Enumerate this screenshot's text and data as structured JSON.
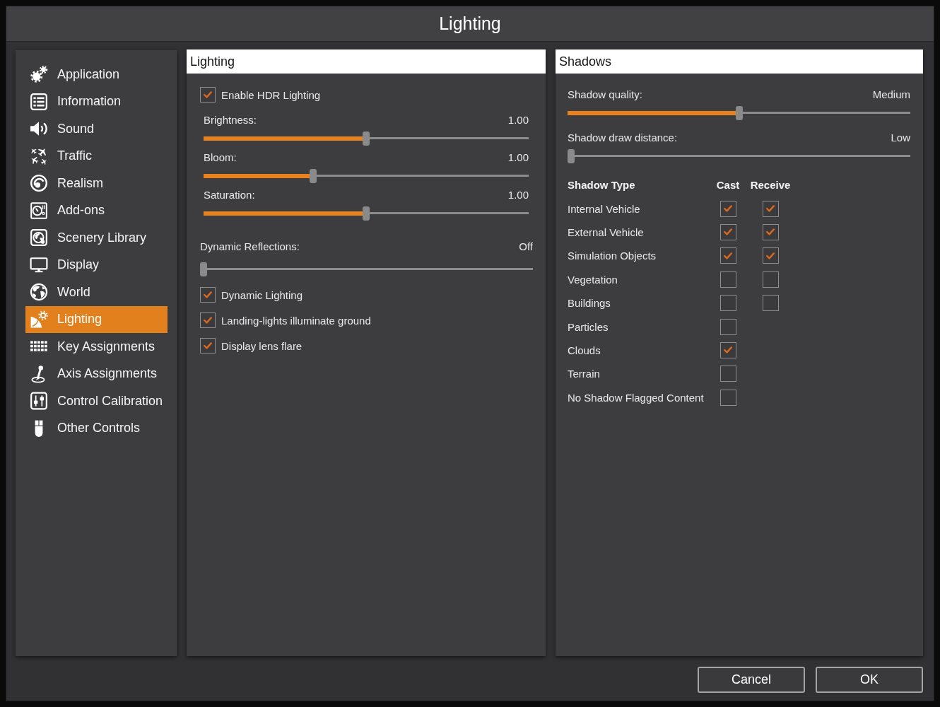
{
  "window": {
    "title": "Lighting"
  },
  "sidebar": {
    "items": [
      {
        "label": "Application",
        "selected": false
      },
      {
        "label": "Information",
        "selected": false
      },
      {
        "label": "Sound",
        "selected": false
      },
      {
        "label": "Traffic",
        "selected": false
      },
      {
        "label": "Realism",
        "selected": false
      },
      {
        "label": "Add-ons",
        "selected": false
      },
      {
        "label": "Scenery Library",
        "selected": false
      },
      {
        "label": "Display",
        "selected": false
      },
      {
        "label": "World",
        "selected": false
      },
      {
        "label": "Lighting",
        "selected": true
      },
      {
        "label": "Key Assignments",
        "selected": false
      },
      {
        "label": "Axis Assignments",
        "selected": false
      },
      {
        "label": "Control Calibration",
        "selected": false
      },
      {
        "label": "Other Controls",
        "selected": false
      }
    ]
  },
  "lighting_panel": {
    "title": "Lighting",
    "hdr": {
      "label": "Enable HDR Lighting",
      "checked": true
    },
    "hdr_sliders": [
      {
        "label": "Brightness:",
        "reading": "1.00",
        "level": 0.5
      },
      {
        "label": "Bloom:",
        "reading": "1.00",
        "level": 0.34
      },
      {
        "label": "Saturation:",
        "reading": "1.00",
        "level": 0.5
      }
    ],
    "reflections": {
      "label": "Dynamic Reflections:",
      "reading": "Off",
      "level": 0
    },
    "options": [
      {
        "label": "Dynamic Lighting",
        "checked": true
      },
      {
        "label": "Landing-lights illuminate ground",
        "checked": true
      },
      {
        "label": "Display lens flare",
        "checked": true
      }
    ]
  },
  "shadows_panel": {
    "title": "Shadows",
    "sliders": [
      {
        "label": "Shadow quality:",
        "reading": "Medium",
        "level": 0.5
      },
      {
        "label": "Shadow draw distance:",
        "reading": "Low",
        "level": 0
      }
    ],
    "table": {
      "columns": [
        "Shadow Type",
        "Cast",
        "Receive"
      ],
      "rows": [
        {
          "label": "Internal Vehicle",
          "cast": true,
          "receive": true
        },
        {
          "label": "External Vehicle",
          "cast": true,
          "receive": true
        },
        {
          "label": "Simulation Objects",
          "cast": true,
          "receive": true
        },
        {
          "label": "Vegetation",
          "cast": false,
          "receive": false
        },
        {
          "label": "Buildings",
          "cast": false,
          "receive": false
        },
        {
          "label": "Particles",
          "cast": false
        },
        {
          "label": "Clouds",
          "cast": true
        },
        {
          "label": "Terrain",
          "cast": false
        },
        {
          "label": "No Shadow Flagged Content",
          "cast": false
        }
      ]
    }
  },
  "buttons": [
    {
      "label": "Cancel"
    },
    {
      "label": "OK"
    }
  ]
}
